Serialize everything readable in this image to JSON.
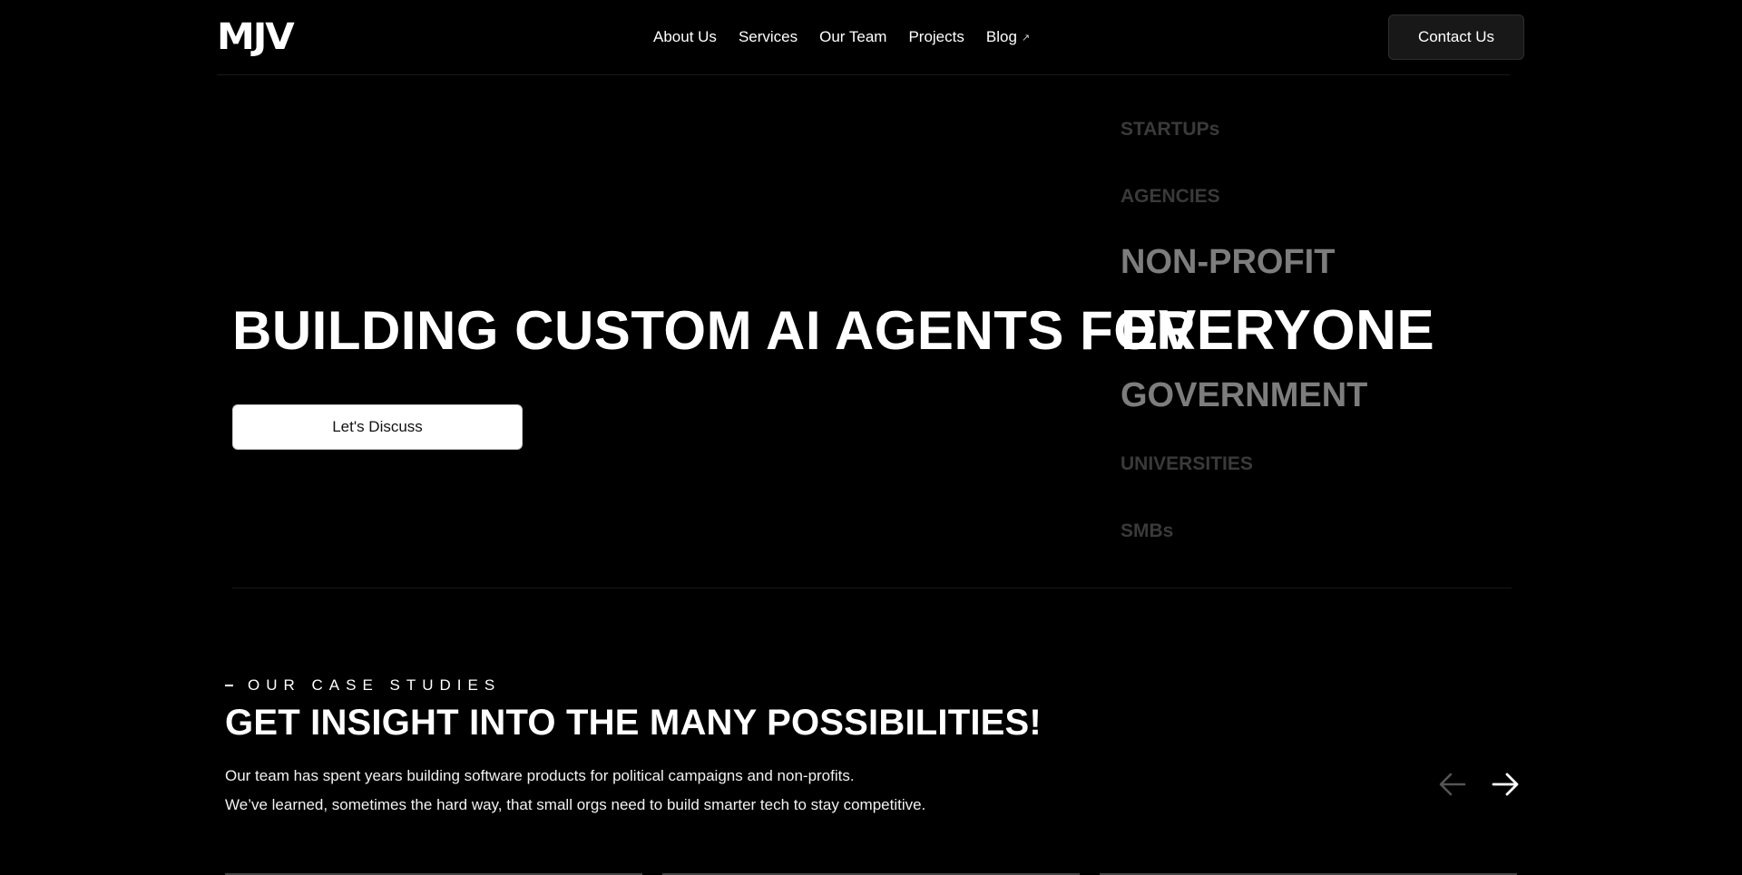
{
  "header": {
    "logo_text": "MJV",
    "nav": [
      {
        "label": "About Us"
      },
      {
        "label": "Services"
      },
      {
        "label": "Our Team"
      },
      {
        "label": "Projects"
      },
      {
        "label": "Blog",
        "icon": "external-link-icon",
        "icon_glyph": "↗"
      }
    ],
    "contact_label": "Contact Us"
  },
  "hero": {
    "title": "BUILDING CUSTOM AI AGENTS FOR",
    "audiences": [
      "STARTUPs",
      "AGENCIES",
      "NON-PROFIT",
      "EVERYONE",
      "GOVERNMENT",
      "UNIVERSITIES",
      "SMBs"
    ],
    "cta_label": "Let's Discuss"
  },
  "case_studies": {
    "eyebrow": "OUR CASE STUDIES",
    "title": "GET INSIGHT INTO THE MANY POSSIBILITIES!",
    "paragraph_1": "Our team has spent years building software products for political campaigns and non-profits.",
    "paragraph_2": "We’ve learned, sometimes the hard way, that small orgs need to build smarter tech to stay competitive.",
    "prev_icon": "arrow-left-icon",
    "next_icon": "arrow-right-icon"
  },
  "colors": {
    "background": "#000000",
    "text": "#ffffff",
    "muted_far": "#3a3a3a",
    "muted_near": "#7d7d7d",
    "button_dark": "#181818"
  }
}
